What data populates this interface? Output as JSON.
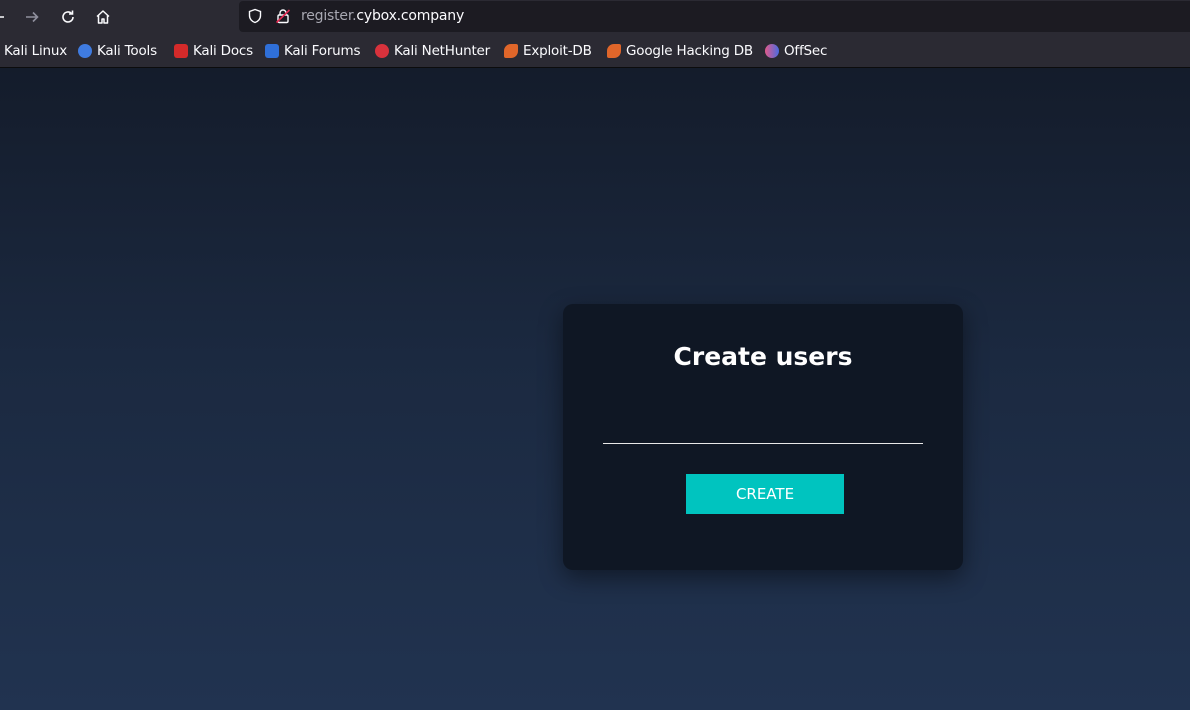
{
  "browser": {
    "url_subdomain": "register.",
    "url_domain": "cybox.company",
    "bookmarks": [
      {
        "label": "Kali Linux",
        "icon": "kali-dragon-icon",
        "color": "#367bf0"
      },
      {
        "label": "Kali Tools",
        "icon": "kali-tools-icon",
        "color": "#3f7be0"
      },
      {
        "label": "Kali Docs",
        "icon": "kali-docs-icon",
        "color": "#d42a2a"
      },
      {
        "label": "Kali Forums",
        "icon": "kali-forums-icon",
        "color": "#2f6fd8"
      },
      {
        "label": "Kali NetHunter",
        "icon": "kali-nethunter-icon",
        "color": "#d8323c"
      },
      {
        "label": "Exploit-DB",
        "icon": "exploit-db-icon",
        "color": "#e0662a"
      },
      {
        "label": "Google Hacking DB",
        "icon": "ghdb-icon",
        "color": "#e0662a"
      },
      {
        "label": "OffSec",
        "icon": "offsec-icon",
        "color": "#6a5bd6"
      }
    ]
  },
  "form": {
    "title": "Create users",
    "input_value": "",
    "button_label": "CREATE"
  }
}
